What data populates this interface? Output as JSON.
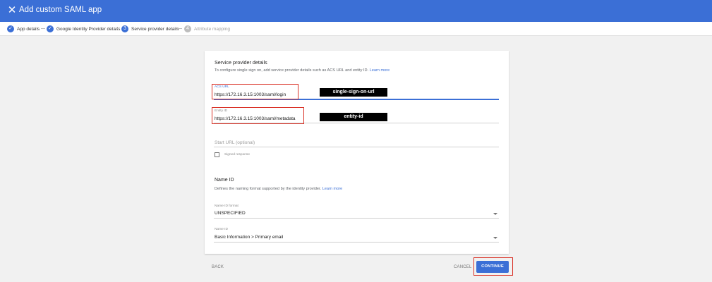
{
  "header": {
    "close_icon": "close-icon",
    "title": "Add custom SAML app",
    "color": "#3b6fd6"
  },
  "stepper": {
    "steps": [
      {
        "label": "App details",
        "marker": "✓",
        "state": "completed"
      },
      {
        "label": "Google Identity Provider details",
        "marker": "✓",
        "state": "completed"
      },
      {
        "label": "Service provider details",
        "marker": "3",
        "state": "active"
      },
      {
        "label": "Attribute mapping",
        "marker": "4",
        "state": "inactive"
      }
    ]
  },
  "card": {
    "heading": "Service provider details",
    "description": "To configure single sign on, add service provider details such as ACS URL and entity ID.",
    "learn_more": "Learn more",
    "acs": {
      "label": "ACS URL",
      "value": "https://172.16.3.15:1003/saml/login",
      "annotation": "single-sign-on-url"
    },
    "entity": {
      "label": "Entity ID",
      "value": "https://172.16.3.15:1003/saml/metadata",
      "annotation": "entity-id"
    },
    "start_url": {
      "placeholder": "Start URL (optional)"
    },
    "signed_response": {
      "label": "Signed response",
      "checked": false
    },
    "name_id": {
      "heading": "Name ID",
      "description": "Defines the naming format supported by the identity provider.",
      "learn_more": "Learn more",
      "format": {
        "label": "Name ID format",
        "value": "UNSPECIFIED"
      },
      "id": {
        "label": "Name ID",
        "value": "Basic Information > Primary email"
      }
    }
  },
  "footer": {
    "back": "BACK",
    "cancel": "CANCEL",
    "continue": "CONTINUE"
  },
  "colors": {
    "accent": "#3b6fd6",
    "highlight": "#d93025"
  }
}
